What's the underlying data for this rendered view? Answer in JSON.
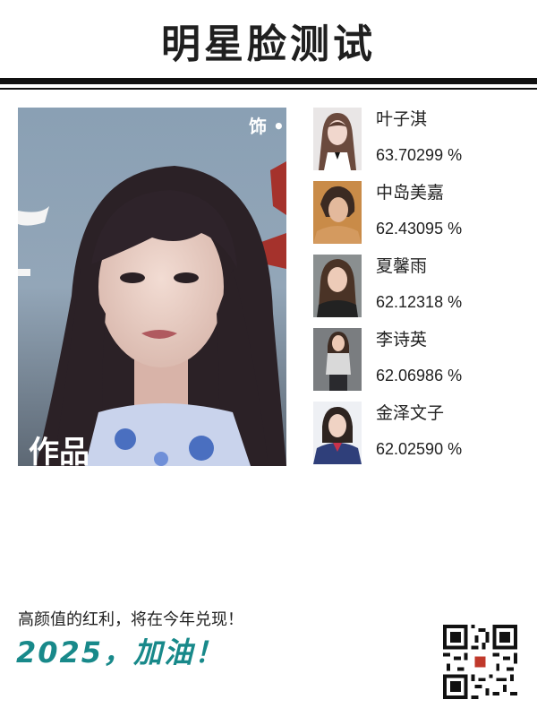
{
  "header": {
    "title": "明星脸测试"
  },
  "main_photo": {
    "overlay_text_top": "饰 •",
    "overlay_text_bottom": "作品"
  },
  "matches": [
    {
      "name": "叶子淇",
      "score": "63.70299 %"
    },
    {
      "name": "中岛美嘉",
      "score": "62.43095 %"
    },
    {
      "name": "夏馨雨",
      "score": "62.12318 %"
    },
    {
      "name": "李诗英",
      "score": "62.06986 %"
    },
    {
      "name": "金泽文子",
      "score": "62.02590 %"
    }
  ],
  "footer": {
    "slogan": "高颜值的红利，将在今年兑现！",
    "headline": "2025，加油！"
  },
  "colors": {
    "accent": "#18898a",
    "text": "#222222",
    "rule": "#111111"
  }
}
